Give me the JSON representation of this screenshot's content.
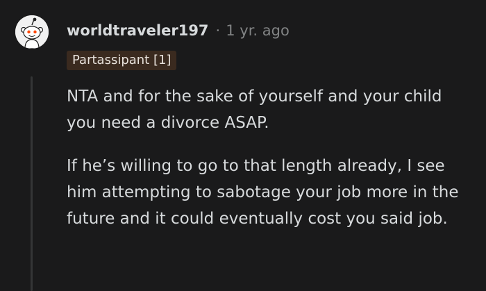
{
  "comment": {
    "author": "worldtraveler197",
    "separator": "·",
    "time": "1 yr. ago",
    "flair": "Partassipant [1]",
    "paragraphs": [
      "NTA and for the sake of yourself and your child you need a divorce ASAP.",
      "If he’s willing to go to that length already, I see him attempting to sabotage your job more in the future and it could eventually cost you said job."
    ]
  },
  "icons": {
    "avatar": "snoo-avatar-icon"
  },
  "colors": {
    "background": "#1a1a1b",
    "text": "#d7dadc",
    "meta": "#818384",
    "flair_bg": "#3a2a1f",
    "snoo_eyes": "#ff4500"
  }
}
